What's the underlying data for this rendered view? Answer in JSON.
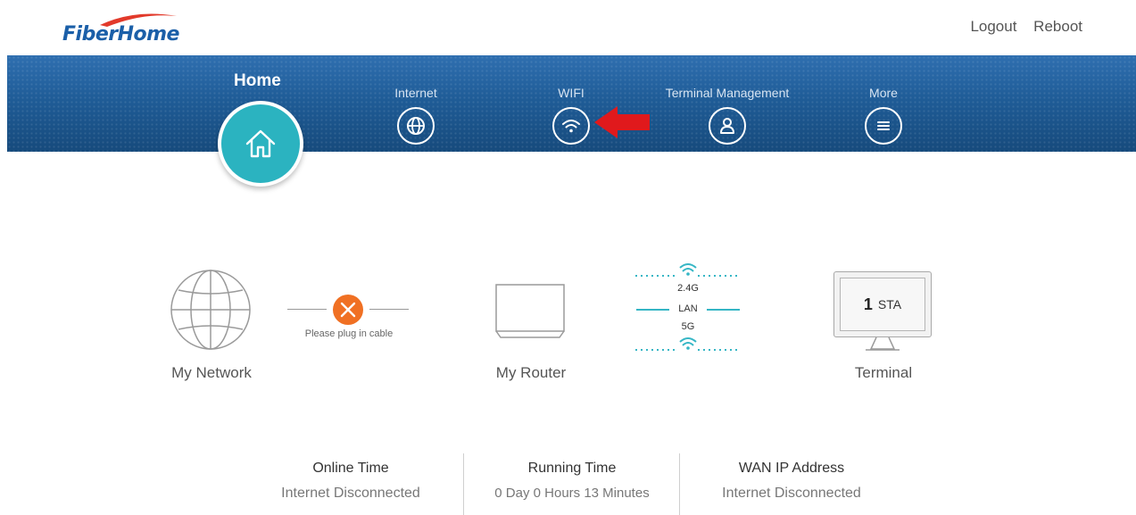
{
  "header": {
    "logo_text": "FiberHome",
    "links": {
      "logout": "Logout",
      "reboot": "Reboot"
    }
  },
  "nav": {
    "home": "Home",
    "internet": "Internet",
    "wifi": "WIFI",
    "terminal_management": "Terminal Management",
    "more": "More"
  },
  "topology": {
    "my_network": "My Network",
    "cable_status": "Please plug in cable",
    "my_router": "My Router",
    "band_24": "2.4G",
    "lan": "LAN",
    "band_5": "5G",
    "sta_count": "1",
    "sta_unit": "STA",
    "terminal": "Terminal"
  },
  "info": [
    {
      "title": "Online Time",
      "value": "Internet Disconnected"
    },
    {
      "title": "Running Time",
      "value": "0 Day 0 Hours 13 Minutes"
    },
    {
      "title": "WAN IP Address",
      "value": "Internet Disconnected"
    }
  ],
  "colors": {
    "brand_blue": "#1b5fa8",
    "nav_band": "#1f5c97",
    "home_teal": "#2bb3c0",
    "error_orange": "#f07023",
    "wifi_teal": "#35b6c5",
    "annotation_red": "#e0191c"
  }
}
